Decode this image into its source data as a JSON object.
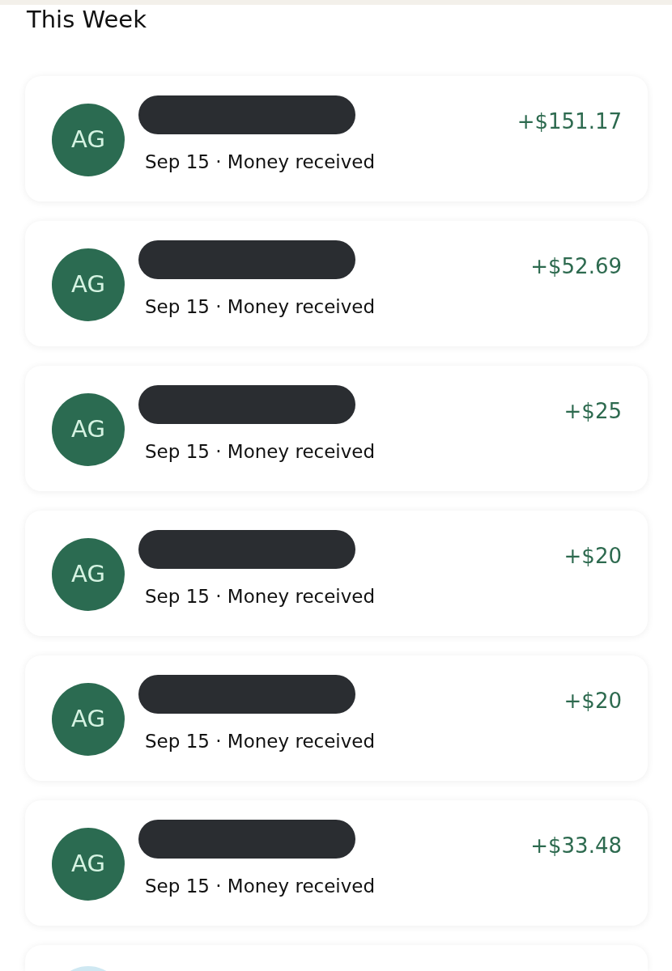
{
  "section_title": "This Week",
  "transactions": [
    {
      "kind": "full",
      "initials": "AG",
      "color": "#2b6b51",
      "name_redacted": true,
      "subtitle": "Sep 15 · Money received",
      "amount": "+$151.17"
    },
    {
      "kind": "full",
      "initials": "AG",
      "color": "#2b6b51",
      "name_redacted": true,
      "subtitle": "Sep 15 · Money received",
      "amount": "+$52.69"
    },
    {
      "kind": "full",
      "initials": "AG",
      "color": "#2b6b51",
      "name_redacted": true,
      "subtitle": "Sep 15 · Money received",
      "amount": "+$25"
    },
    {
      "kind": "full",
      "initials": "AG",
      "color": "#2b6b51",
      "name_redacted": true,
      "subtitle": "Sep 15 · Money received",
      "amount": "+$20"
    },
    {
      "kind": "full",
      "initials": "AG",
      "color": "#2b6b51",
      "name_redacted": true,
      "subtitle": "Sep 15 · Money received",
      "amount": "+$20"
    },
    {
      "kind": "full",
      "initials": "AG",
      "color": "#2b6b51",
      "name_redacted": true,
      "subtitle": "Sep 15 · Money received",
      "amount": "+$33.48"
    },
    {
      "kind": "clipped",
      "color": "#cfe8f2"
    }
  ]
}
